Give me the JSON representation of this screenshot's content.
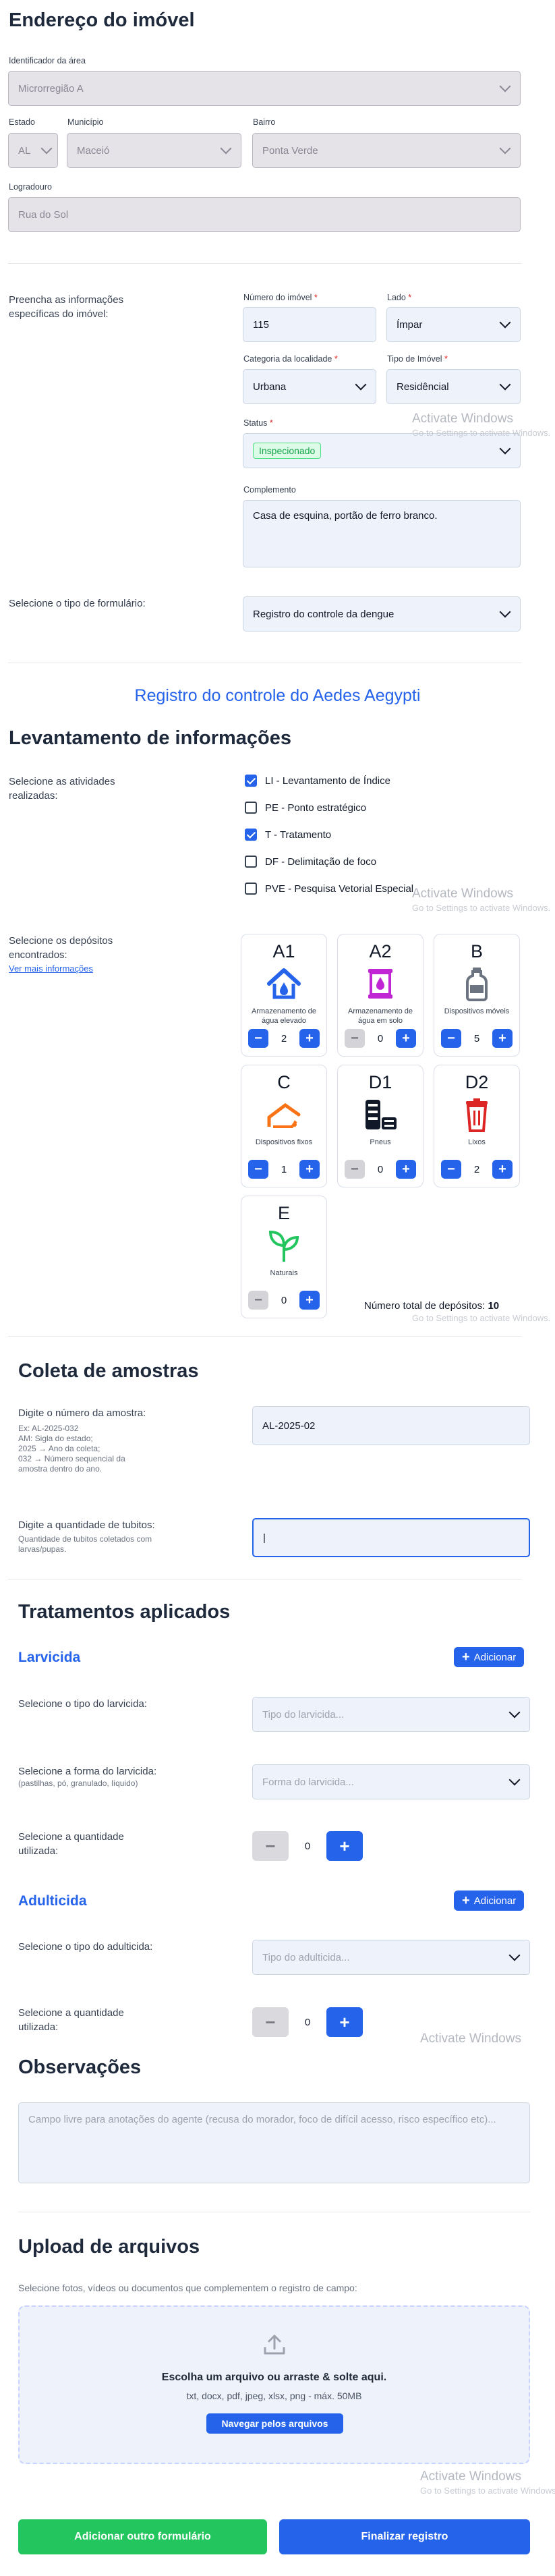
{
  "address": {
    "title": "Endereço do imóvel",
    "area_id_label": "Identificador da área",
    "area_id_value": "Microrregião A",
    "state_label": "Estado",
    "state_value": "AL",
    "city_label": "Município",
    "city_value": "Maceió",
    "district_label": "Bairro",
    "district_value": "Ponta Verde",
    "street_label": "Logradouro",
    "street_value": "Rua do Sol"
  },
  "property": {
    "intro": "Preencha as informações específicas do imóvel:",
    "number_label": "Número do imóvel",
    "number_value": "115",
    "side_label": "Lado",
    "side_value": "Ímpar",
    "locality_label": "Categoria da localidade",
    "locality_value": "Urbana",
    "type_label": "Tipo de Imóvel",
    "type_value": "Residêncial",
    "status_label": "Status",
    "status_value": "Inspecionado",
    "complement_label": "Complemento",
    "complement_value": "Casa de esquina, portão de ferro branco.",
    "req_mark": "*"
  },
  "form_type": {
    "label": "Selecione o tipo de formulário:",
    "value": "Registro do controle da dengue"
  },
  "registry": {
    "title": "Registro do controle do Aedes Aegypti",
    "survey_title": "Levantamento de informações",
    "activities_label": "Selecione as atividades realizadas:",
    "activities": [
      {
        "label": "LI - Levantamento de Índice",
        "checked": true
      },
      {
        "label": "PE - Ponto estratégico",
        "checked": false
      },
      {
        "label": "T - Tratamento",
        "checked": true
      },
      {
        "label": "DF - Delimitação de foco",
        "checked": false
      },
      {
        "label": "PVE - Pesquisa Vetorial Especial",
        "checked": false
      }
    ],
    "deposits_label": "Selecione os depósitos encontrados:",
    "more_info": "Ver mais informações",
    "deposits": [
      {
        "code": "A1",
        "name": "Armazenamento de água elevado",
        "count": "2",
        "icon": "house-water-icon"
      },
      {
        "code": "A2",
        "name": "Armazenamento de água em solo",
        "count": "0",
        "icon": "ground-tank-icon"
      },
      {
        "code": "B",
        "name": "Dispositivos móveis",
        "count": "5",
        "icon": "bottle-icon"
      },
      {
        "code": "C",
        "name": "Dispositivos fixos",
        "count": "1",
        "icon": "gutter-icon"
      },
      {
        "code": "D1",
        "name": "Pneus",
        "count": "0",
        "icon": "tires-icon"
      },
      {
        "code": "D2",
        "name": "Lixos",
        "count": "2",
        "icon": "trash-icon"
      },
      {
        "code": "E",
        "name": "Naturais",
        "count": "0",
        "icon": "sprout-icon"
      }
    ],
    "total_label": "Número total de depósitos:",
    "total_value": "10"
  },
  "samples": {
    "title": "Coleta de amostras",
    "sample_label": "Digite o número da amostra:",
    "sample_hint": "Ex: AL-2025-032\nAM: Sigla do estado;\n2025 → Ano da coleta;\n032 → Número sequencial da amostra dentro do ano.",
    "sample_value": "AL-2025-02",
    "tubes_label": "Digite a quantidade de tubitos:",
    "tubes_hint": "Quantidade de tubitos coletados com larvas/pupas.",
    "tubes_value": "|"
  },
  "treatments": {
    "title": "Tratamentos aplicados",
    "add_label": "Adicionar",
    "larvicide_title": "Larvicida",
    "larvicide_type_label": "Selecione o tipo do larvicida:",
    "larvicide_type_placeholder": "Tipo do larvicida...",
    "larvicide_form_label": "Selecione a forma do larvicida:",
    "larvicide_form_hint": "(pastilhas, pó, granulado, líquido)",
    "larvicide_form_placeholder": "Forma do larvicida...",
    "larvicide_qty_label": "Selecione a quantidade utilizada:",
    "larvicide_qty": "0",
    "adulticide_title": "Adulticida",
    "adulticide_type_label": "Selecione o tipo do adulticida:",
    "adulticide_type_placeholder": "Tipo do adulticida...",
    "adulticide_qty_label": "Selecione a quantidade utilizada:",
    "adulticide_qty": "0"
  },
  "notes": {
    "title": "Observações",
    "placeholder": "Campo livre para anotações do agente (recusa do morador, foco de difícil acesso, risco específico etc)..."
  },
  "upload": {
    "title": "Upload de arquivos",
    "hint": "Selecione fotos, vídeos ou documentos que complementem o registro de campo:",
    "drop_title": "Escolha um arquivo ou arraste & solte aqui.",
    "drop_types": "txt, docx, pdf, jpeg, xlsx, png - máx. 50MB",
    "browse_label": "Navegar pelos arquivos"
  },
  "actions": {
    "add_form_label": "Adicionar outro formulário",
    "finish_label": "Finalizar registro"
  },
  "watermark": {
    "line1": "Activate Windows",
    "line2": "Go to Settings to activate Windows."
  },
  "colors": {
    "primary": "#2563eb",
    "green": "#22c55e",
    "status_bg": "#dcfce7",
    "status_text": "#16a34a"
  }
}
